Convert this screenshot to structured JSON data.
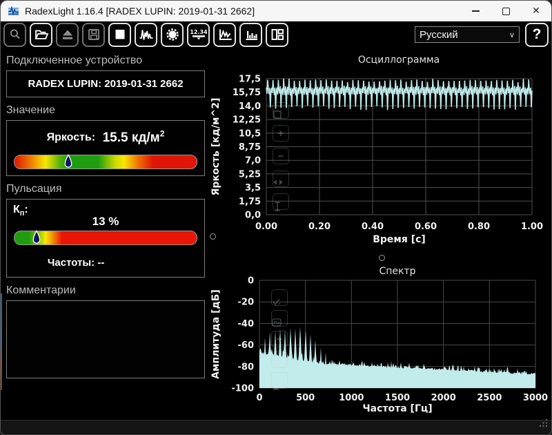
{
  "window": {
    "title": "RadexLight 1.16.4 [RADEX LUPIN: 2019-01-31 2662]",
    "controls": [
      "minimize",
      "maximize",
      "close"
    ]
  },
  "toolbar": {
    "buttons": [
      {
        "name": "preview",
        "icon": "magnifier-icon",
        "enabled": false
      },
      {
        "name": "open",
        "icon": "open-folder-icon",
        "enabled": true
      },
      {
        "name": "eject",
        "icon": "eject-icon",
        "enabled": false
      },
      {
        "name": "save",
        "icon": "save-icon",
        "enabled": false
      },
      {
        "name": "stop",
        "icon": "stop-icon",
        "enabled": true
      },
      {
        "name": "oscillogram-view",
        "icon": "waveform-icon",
        "enabled": true
      },
      {
        "name": "settings",
        "icon": "gear-icon",
        "enabled": true
      },
      {
        "name": "numeric-view",
        "icon": "numeric-display-icon",
        "enabled": true
      },
      {
        "name": "chart-view",
        "icon": "line-chart-icon",
        "enabled": true
      },
      {
        "name": "spectrum-view",
        "icon": "histogram-icon",
        "enabled": true
      },
      {
        "name": "layout-view",
        "icon": "layout-icon",
        "enabled": true
      }
    ],
    "numeric_display_text": "12.34",
    "language_selected": "Русский",
    "help_label": "?"
  },
  "left_panel": {
    "connected_device": {
      "header": "Подключенное устройство",
      "device_name": "RADEX LUPIN: 2019-01-31 2662"
    },
    "value_section": {
      "header": "Значение",
      "label": "Яркость:",
      "value": "15.5",
      "unit": "кд/м",
      "unit_exp": "2",
      "marker_position_pct": 29.7,
      "scale_gradient": [
        [
          "#e01505",
          0
        ],
        [
          "#ef7b00",
          9
        ],
        [
          "#f8e800",
          17
        ],
        [
          "#57b108",
          25
        ],
        [
          "#1e9e0e",
          30
        ],
        [
          "#1e9e0e",
          46
        ],
        [
          "#c8d800",
          55
        ],
        [
          "#f8e800",
          60
        ],
        [
          "#f07000",
          68
        ],
        [
          "#e01505",
          76
        ],
        [
          "#e01505",
          100
        ]
      ]
    },
    "pulsation_section": {
      "header": "Пульсация",
      "label": "К",
      "label_sub": "п",
      "label_colon": ":",
      "value": "13 %",
      "marker_position_pct": 12.3,
      "scale_gradient": [
        [
          "#1e9e0e",
          0
        ],
        [
          "#1e9e0e",
          8
        ],
        [
          "#86c400",
          13
        ],
        [
          "#f8e800",
          17
        ],
        [
          "#f39000",
          21
        ],
        [
          "#ea1505",
          26
        ],
        [
          "#ea1505",
          100
        ]
      ],
      "frequencies_label": "Частоты:",
      "frequencies_value": "--"
    },
    "comments": {
      "header": "Комментарии",
      "text": ""
    }
  },
  "chart_controls": {
    "oscillogram": [
      "reset-frame",
      "zoom-in",
      "zoom-out",
      "fit-horizontal",
      "fit-vertical"
    ],
    "spectrum": [
      "autoscale-check",
      "wave-view",
      "zoom-in",
      "zoom-out",
      "fit-vertical"
    ]
  },
  "chart_data": [
    {
      "type": "line",
      "title": "Осциллограмма",
      "xlabel": "Время [с]",
      "ylabel": "Яркость [кд/м^2]",
      "x_range": [
        0,
        1
      ],
      "x_ticks": [
        "0.00",
        "0.20",
        "0.40",
        "0.60",
        "0.80",
        "1.00"
      ],
      "y_range": [
        0,
        17.5
      ],
      "y_ticks": [
        "17,5",
        "15,75",
        "14,0",
        "12,25",
        "10,5",
        "8,75",
        "7,0",
        "5,25",
        "3,5",
        "1,75",
        "0,0"
      ],
      "line_color": "#bfe9e9",
      "grid_color": "#4f4f4f",
      "series_note": "pulsed lamp luminance, ~50 pulses per second, mean 15.9 kd/m2, peaks 17.5, troughs 13.7",
      "pulse_count": 50,
      "pulse_pattern": [
        16.35,
        15.55,
        17.3,
        16.1,
        15.5,
        16.45,
        13.75,
        16.0
      ],
      "jitter": 0.3,
      "seed": 11
    },
    {
      "type": "area",
      "title": "Спектр",
      "xlabel": "Частота [Гц]",
      "ylabel": "Амплитуда [дБ]",
      "x_range": [
        0,
        3000
      ],
      "x_ticks": [
        0,
        500,
        1000,
        1500,
        2000,
        2500,
        3000
      ],
      "y_range": [
        -100,
        0
      ],
      "y_ticks": [
        0,
        -20,
        -40,
        -60,
        -80,
        -100
      ],
      "fill_color": "#c2ebeb",
      "grid_color": "#4a4a4a",
      "harmonics": [
        [
          7,
          -66
        ],
        [
          60,
          -53
        ],
        [
          115,
          -48
        ],
        [
          170,
          -47
        ],
        [
          225,
          -45
        ],
        [
          280,
          -46
        ],
        [
          335,
          -44
        ],
        [
          390,
          -45
        ],
        [
          445,
          -43
        ],
        [
          500,
          -46
        ],
        [
          555,
          -50
        ],
        [
          610,
          -55
        ],
        [
          665,
          -62
        ],
        [
          720,
          -67
        ],
        [
          1430,
          -75
        ]
      ],
      "noise_floor": {
        "start_db": -68,
        "mid_f": 650,
        "mid_db": -78,
        "end_db": -88
      },
      "jitter_db": 6,
      "seed": 5
    }
  ],
  "statusbar": {
    "text": ""
  }
}
